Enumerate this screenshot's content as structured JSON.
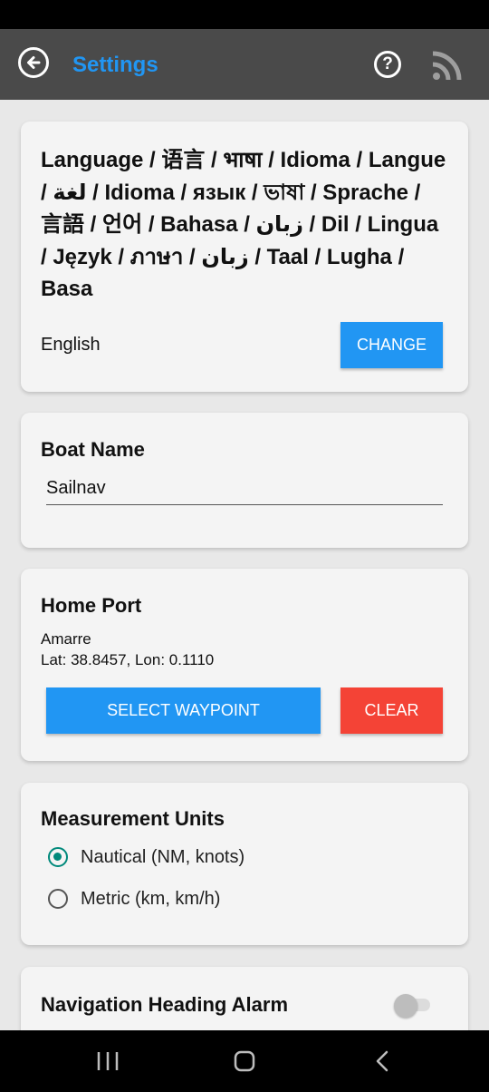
{
  "header": {
    "title": "Settings",
    "back_icon": "arrow-left-circle-icon",
    "help_label": "?",
    "cast_icon": "rss-cast-icon"
  },
  "language": {
    "title": "Language / 语言 / भाषा / Idioma / Langue / لغة / Idioma / язык / ভাষা / Sprache / 言語 / 언어 / Bahasa / زبان / Dil / Lingua / Język / ภาษา / زبان / Taal / Lugha / Basa",
    "current": "English",
    "change_label": "CHANGE"
  },
  "boat": {
    "title": "Boat Name",
    "value": "Sailnav"
  },
  "home_port": {
    "title": "Home Port",
    "name": "Amarre",
    "coords": "Lat: 38.8457, Lon: 0.1110",
    "select_label": "SELECT WAYPOINT",
    "clear_label": "CLEAR"
  },
  "units": {
    "title": "Measurement Units",
    "options": [
      {
        "label": "Nautical (NM, knots)",
        "selected": true
      },
      {
        "label": "Metric (km, km/h)",
        "selected": false
      }
    ]
  },
  "alarm": {
    "title": "Navigation Heading Alarm",
    "enabled": false
  },
  "colors": {
    "accent": "#2196f3",
    "danger": "#f44336",
    "radio": "#00897b",
    "appbar": "#4a4a4a"
  },
  "system_nav": {
    "recents_icon": "recents-icon",
    "home_icon": "home-icon",
    "back_icon": "back-chevron-icon"
  }
}
